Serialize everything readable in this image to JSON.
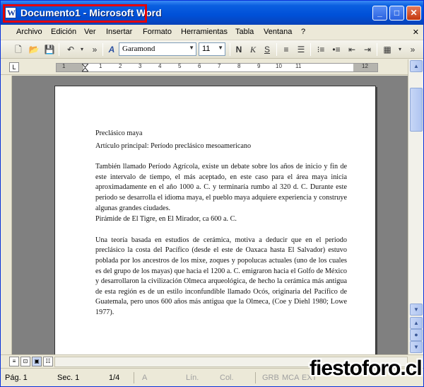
{
  "window": {
    "title": "Documento1 - Microsoft Word",
    "buttons": {
      "minimize": "_",
      "maximize": "□",
      "close": "✕"
    }
  },
  "menu": {
    "items": [
      "Archivo",
      "Edición",
      "Ver",
      "Insertar",
      "Formato",
      "Herramientas",
      "Tabla",
      "Ventana",
      "?"
    ]
  },
  "toolbar": {
    "font_name": "Garamond",
    "font_size": "11",
    "bold": "N",
    "italic": "K",
    "underline": "S"
  },
  "ruler": {
    "numbers": [
      "1",
      "1",
      "2",
      "3",
      "4",
      "5",
      "6",
      "7",
      "8",
      "9",
      "10",
      "11",
      "12"
    ]
  },
  "document": {
    "heading": "Preclásico maya",
    "subheading": "Artículo principal: Período preclásico mesoamericano",
    "paragraph1": "También llamado Período Agrícola, existe un debate sobre los años de inicio y fin de este intervalo de tiempo, el más aceptado, en este caso para el área maya inicia aproximadamente en el año 1000 a. C. y terminaría rumbo al 320 d. C. Durante este periodo se desarrolla el idioma maya, el pueblo maya adquiere experiencia y construye algunas grandes ciudades.",
    "caption": "Pirámide de El Tigre, en El Mirador, ca 600 a. C.",
    "paragraph2": "Una teoría basada en estudios de cerámica, motiva a deducir que en el periodo preclásico la costa del Pacífico (desde el este de Oaxaca hasta El Salvador) estuvo poblada por los ancestros de los mixe, zoques y popolucas actuales (uno de los cuales es del grupo de los mayas) que hacia el 1200 a. C. emigraron hacia el Golfo de México y desarrollaron la civilización Olmeca arqueológica, de hecho la cerámica más antigua de esta región es de un estilo inconfundible llamado Ocós, originaria del Pacífico de Guatemala, pero unos 600 años más antigua que la Olmeca, (Coe y Diehl 1980; Lowe 1977)."
  },
  "status": {
    "page": "Pág. 1",
    "section": "Sec. 1",
    "pages": "1/4",
    "at": "A",
    "line": "Lín.",
    "col": "Col.",
    "grb": "GRB",
    "mca": "MCA",
    "ext": "EXT"
  },
  "watermark": "fiestoforo.cl",
  "colors": {
    "titlebar": "#0050d8",
    "highlight": "#e60000",
    "workspace": "#808080"
  }
}
